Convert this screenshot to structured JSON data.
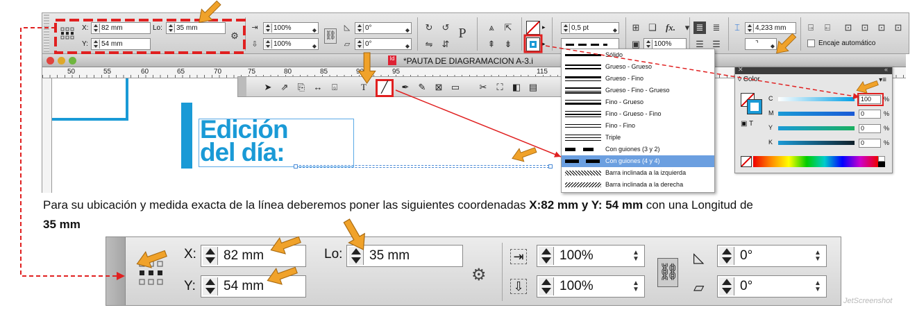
{
  "topbar": {
    "x_label": "X:",
    "x_value": "82 mm",
    "y_label": "Y:",
    "y_value": "54 mm",
    "lo_label": "Lo:",
    "lo_value": "35 mm",
    "scale_x": "100%",
    "scale_y": "100%",
    "rotate": "0°",
    "shear": "0°",
    "stroke_weight": "0,5 pt",
    "zoom_value": "100%",
    "gap_value": "4,233 mm",
    "auto_fit_label": "Encaje automático",
    "fx_label": "fx.",
    "text_tool_label": "P"
  },
  "document": {
    "title": "*PAUTA DE DIAGRAMACION A-3.i",
    "ruler_numbers": [
      "50",
      "55",
      "60",
      "65",
      "70",
      "75",
      "80",
      "85",
      "90",
      "95",
      "115"
    ],
    "headline_line1": "Edición",
    "headline_line2": "del día:"
  },
  "stroke_menu": {
    "items": [
      "Sólido",
      "Grueso - Grueso",
      "Grueso - Fino",
      "Grueso - Fino - Grueso",
      "Fino - Grueso",
      "Fino - Grueso - Fino",
      "Fino - Fino",
      "Triple",
      "Con guiones (3 y 2)",
      "Con guiones (4 y 4)",
      "Barra inclinada a la izquierda",
      "Barra inclinada a la derecha"
    ],
    "selected": "Con guiones (4 y 4)"
  },
  "color_panel": {
    "tab_label": "Color",
    "channels": [
      {
        "name": "C",
        "value": "100"
      },
      {
        "name": "M",
        "value": "0"
      },
      {
        "name": "Y",
        "value": "0"
      },
      {
        "name": "K",
        "value": "0"
      }
    ],
    "percent": "%"
  },
  "instruction": {
    "part1": "Para su ubicación y medida exacta de la línea deberemos poner las siguientes coordenadas ",
    "bold1": "X:82 mm y Y: 54 mm",
    "part2": " con una Longitud de",
    "bold2": "35 mm"
  },
  "zoom_bar": {
    "x_label": "X:",
    "x_value": "82 mm",
    "y_label": "Y:",
    "y_value": "54 mm",
    "lo_label": "Lo:",
    "lo_value": "35 mm",
    "scale_x": "100%",
    "scale_y": "100%",
    "rotate": "0°",
    "shear": "0°"
  },
  "watermark": "JetScreenshot",
  "colors": {
    "accent_blue": "#1a9ad6",
    "arrow_orange": "#f0a22a",
    "highlight_red": "#e02020",
    "menu_selected": "#6b9fe0"
  }
}
